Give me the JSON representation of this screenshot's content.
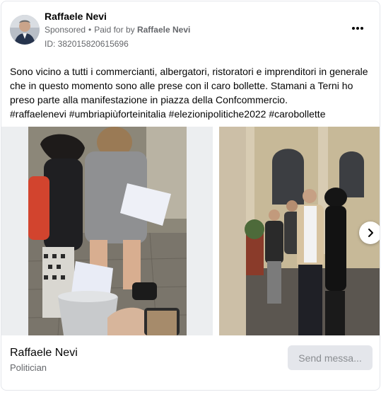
{
  "post": {
    "author": "Raffaele Nevi",
    "sponsored_label": "Sponsored",
    "dot": "•",
    "paid_for_prefix": "Paid for by",
    "paid_for_name": "Raffaele Nevi",
    "ad_id": "ID: 382015820615696",
    "text_lines": [
      "Sono vicino a tutti i commercianti, albergatori, ristoratori e imprenditori in generale",
      "che in questo momento sono alle prese con il caro bollette. Stamani a Terni ho",
      "preso parte alla manifestazione in piazza della Confcommercio.",
      "#raffaelenevi #umbriapiùforteinitalia #elezionipolitiche2022 #carobollette"
    ]
  },
  "carousel": {
    "images": [
      "photo-collecting-bills",
      "photo-group-in-square"
    ],
    "next_icon": "chevron-right-icon"
  },
  "footer": {
    "page_name": "Raffaele Nevi",
    "category": "Politician",
    "send_label": "Send messa..."
  },
  "icons": {
    "more": "more-horizontal-icon"
  }
}
